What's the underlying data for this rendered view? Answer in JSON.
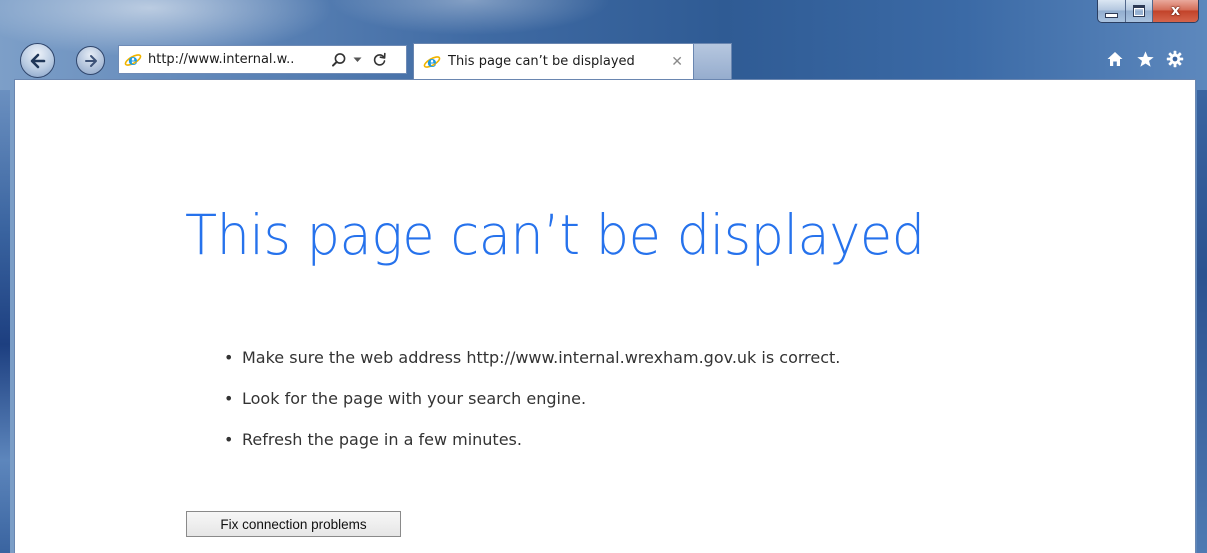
{
  "window": {
    "close_glyph": "x"
  },
  "nav": {
    "back_icon": "back-arrow-icon",
    "forward_icon": "forward-arrow-icon"
  },
  "address_bar": {
    "value": "http://www.internal.w..",
    "search_icon": "search-icon",
    "dropdown_icon": "chevron-down-icon",
    "refresh_icon": "refresh-icon"
  },
  "tab": {
    "label": "This page can’t be displayed",
    "close_glyph": "✕"
  },
  "toolbar": {
    "icons": [
      "home-icon",
      "favorites-icon",
      "gear-icon"
    ]
  },
  "content": {
    "title": "This page can’t be displayed",
    "suggestions": [
      "Make sure the web address http://www.internal.wrexham.gov.uk is correct.",
      "Look for the page with your search engine.",
      "Refresh the page in a few minutes."
    ],
    "bullet": "•",
    "fix_button_label": "Fix connection problems"
  },
  "colors": {
    "title_blue": "#2672ec",
    "ie_blue": "#1e9ae0",
    "ie_gold": "#f0b400"
  }
}
